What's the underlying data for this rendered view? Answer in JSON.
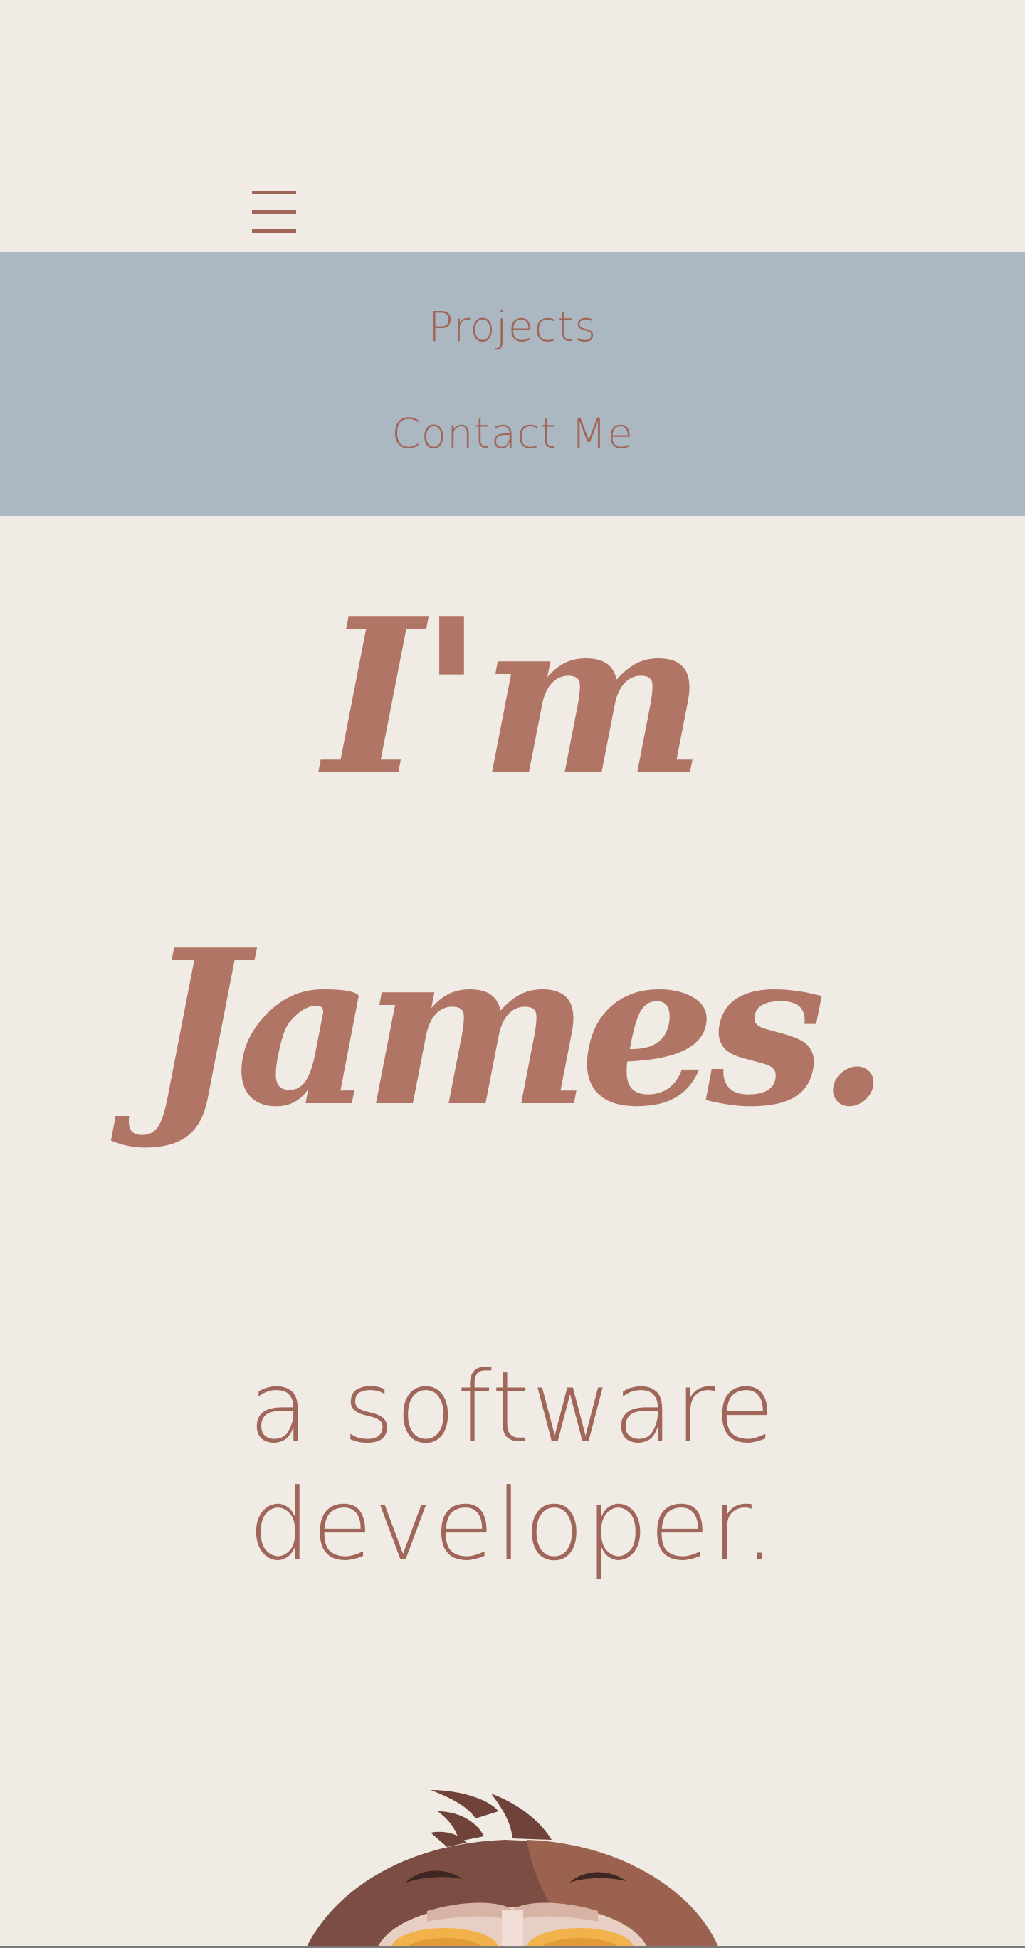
{
  "nav": {
    "menu_icon": "hamburger-menu-icon",
    "links": [
      "Projects",
      "Contact Me"
    ]
  },
  "hero": {
    "greeting": "I'm",
    "name": "James.",
    "role_line1": "a software",
    "role_line2": "developer."
  },
  "colors": {
    "background": "#f0ebe4",
    "nav_panel": "#abb8c1",
    "accent_text": "#a0665a",
    "script_text": "#b07565"
  },
  "avatar": {
    "icon": "avatar-illustration"
  }
}
